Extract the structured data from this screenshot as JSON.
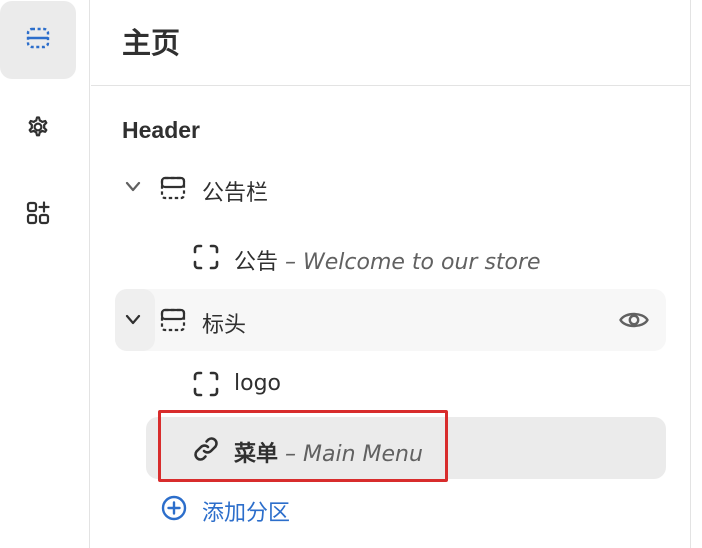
{
  "rail": {
    "items": [
      {
        "icon": "sections-icon",
        "active": true
      },
      {
        "icon": "gear-icon",
        "active": false
      },
      {
        "icon": "apps-icon",
        "active": false
      }
    ]
  },
  "page": {
    "title": "主页"
  },
  "header_section": {
    "heading": "Header",
    "announcement_bar": {
      "label": "公告栏",
      "child": {
        "label": "公告",
        "subtitle": "– Welcome to our store"
      }
    },
    "header": {
      "label": "标头",
      "children": [
        {
          "label": "logo"
        },
        {
          "label": "菜单",
          "subtitle": "– Main Menu"
        }
      ]
    },
    "add_section_label": "添加分区"
  },
  "colors": {
    "accent": "#2c6ecb",
    "highlight": "#d82c2c"
  }
}
